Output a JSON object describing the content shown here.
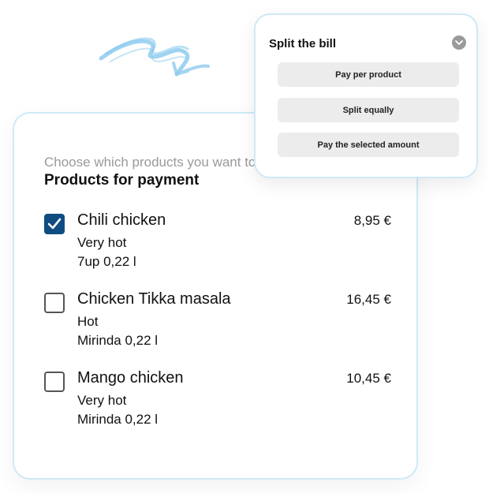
{
  "split_bill": {
    "title": "Split the bill",
    "options": [
      {
        "label": "Pay per product"
      },
      {
        "label": "Split equally"
      },
      {
        "label": "Pay the selected amount"
      }
    ]
  },
  "products_card": {
    "instruction": "Choose which products you want to pay",
    "title": "Products for payment",
    "products": [
      {
        "name": "Chili chicken",
        "description": "Very hot",
        "drink": "7up 0,22 l",
        "price": "8,95 €",
        "selected": true
      },
      {
        "name": "Chicken Tikka masala",
        "description": "Hot",
        "drink": "Mirinda 0,22 l",
        "price": "16,45 €",
        "selected": false
      },
      {
        "name": "Mango chicken",
        "description": "Very hot",
        "drink": "Mirinda 0,22 l",
        "price": "10,45 €",
        "selected": false
      }
    ]
  },
  "colors": {
    "accent": "#0f4c81",
    "card_border": "#cfe9f8",
    "option_bg": "#ececec",
    "squiggle": "#8ecbee"
  },
  "icons": {
    "decoration": "squiggle-arrow-icon",
    "dropdown": "chevron-down-icon",
    "checkmark": "checkmark-icon"
  }
}
